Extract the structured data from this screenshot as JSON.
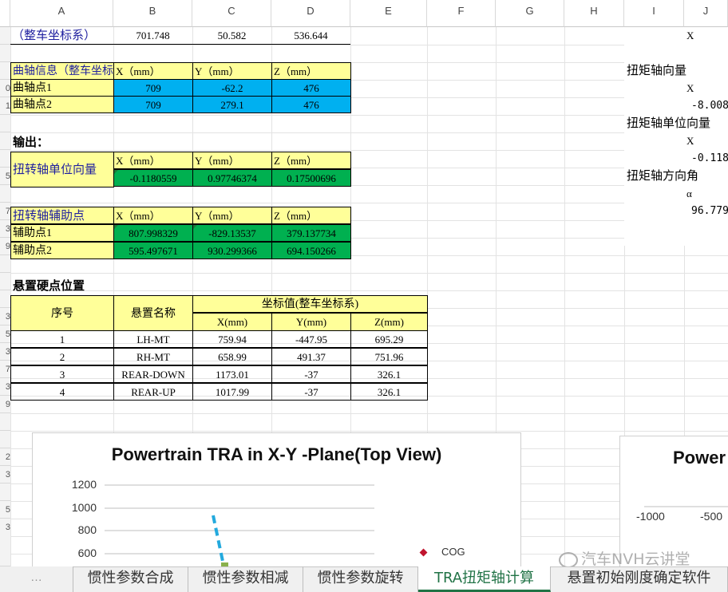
{
  "columns": [
    "A",
    "B",
    "C",
    "D",
    "E",
    "F",
    "G",
    "H",
    "I",
    "J"
  ],
  "row_numbers": [
    "",
    "",
    "",
    "0",
    "1",
    "",
    "",
    "",
    "5",
    "",
    "7",
    "3",
    "9",
    "",
    "",
    "",
    "3",
    "5",
    "3",
    "7",
    "3",
    "9",
    "",
    "",
    "2",
    "3",
    "",
    "5",
    "3"
  ],
  "vehicle_coords": {
    "label": "（整车坐标系）",
    "b": "701.748",
    "c": "50.582",
    "d": "536.644"
  },
  "crank": {
    "header": {
      "label": "曲轴信息（整车坐标系）",
      "x": "X（mm）",
      "y": "Y（mm）",
      "z": "Z（mm）"
    },
    "rows": [
      {
        "label": "曲轴点1",
        "x": "709",
        "y": "-62.2",
        "z": "476"
      },
      {
        "label": "曲轴点2",
        "x": "709",
        "y": "279.1",
        "z": "476"
      }
    ]
  },
  "output_label": "输出：",
  "unit_vector": {
    "header": {
      "label": "扭转轴单位向量",
      "x": "X（mm）",
      "y": "Y（mm）",
      "z": "Z（mm）"
    },
    "values": {
      "x": "-0.1180559",
      "y": "0.97746374",
      "z": "0.17500696"
    }
  },
  "aux": {
    "header": {
      "label": "扭转轴辅助点",
      "x": "X（mm）",
      "y": "Y（mm）",
      "z": "Z（mm）"
    },
    "rows": [
      {
        "label": "辅助点1",
        "x": "807.998329",
        "y": "-829.13537",
        "z": "379.137734"
      },
      {
        "label": "辅助点2",
        "x": "595.497671",
        "y": "930.299366",
        "z": "694.150266"
      }
    ]
  },
  "mount": {
    "title": "悬置硬点位置",
    "header": {
      "no": "序号",
      "name": "悬置名称",
      "coord": "坐标值(整车坐标系)",
      "x": "X(mm)",
      "y": "Y(mm)",
      "z": "Z(mm)"
    },
    "rows": [
      {
        "no": "1",
        "name": "LH-MT",
        "x": "759.94",
        "y": "-447.95",
        "z": "695.29"
      },
      {
        "no": "2",
        "name": "RH-MT",
        "x": "658.99",
        "y": "491.37",
        "z": "751.96"
      },
      {
        "no": "3",
        "name": "REAR-DOWN",
        "x": "1173.01",
        "y": "-37",
        "z": "326.1"
      },
      {
        "no": "4",
        "name": "REAR-UP",
        "x": "1017.99",
        "y": "-37",
        "z": "326.1"
      }
    ]
  },
  "right_panel": {
    "r1": "X",
    "r2": "扭矩轴向量",
    "r3": "X",
    "r4": "-8.008",
    "r5": "扭矩轴单位向量",
    "r6": "X",
    "r7": "-0.118",
    "r8": "扭矩轴方向角",
    "r9": "α",
    "r10": "96.779"
  },
  "chart_data": [
    {
      "type": "line",
      "title": "Powertrain TRA in X-Y -Plane(Top View)",
      "yticks": [
        "1200",
        "1000",
        "800",
        "600"
      ],
      "ylim": [
        600,
        1200
      ],
      "legend": [
        "COG"
      ],
      "colors": {
        "line": "#23a9dd",
        "cog": "#c0142e",
        "marker": "#8ab04b"
      }
    },
    {
      "type": "line",
      "title": "Power",
      "xticks": [
        "-1000",
        "-500"
      ]
    }
  ],
  "watermark": "汽车NVH云讲堂",
  "tabs": [
    "惯性参数合成",
    "惯性参数相减",
    "惯性参数旋转",
    "TRA扭矩轴计算",
    "悬置初始刚度确定软件"
  ],
  "active_tab": 3
}
